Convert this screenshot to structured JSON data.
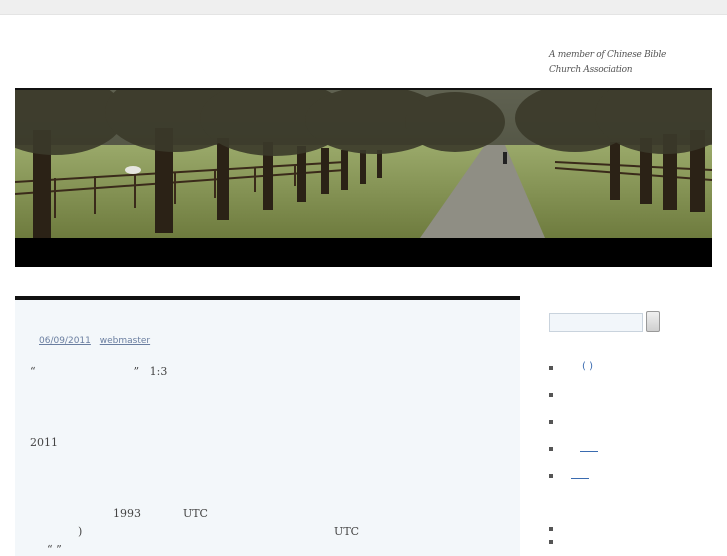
{
  "header": {
    "tagline": "A member of Chinese Bible Church Association"
  },
  "post": {
    "date": "06/09/2011",
    "author": "webmaster",
    "lines": [
      "“                            ”   1:3",
      "2011",
      "1993            UTC",
      ")                                                                        UTC",
      "“ ”"
    ]
  },
  "sidebar": {
    "items": [
      {
        "label": "(  )"
      },
      {
        "label": ""
      },
      {
        "label": ""
      },
      {
        "label": ""
      },
      {
        "label": ""
      }
    ]
  }
}
